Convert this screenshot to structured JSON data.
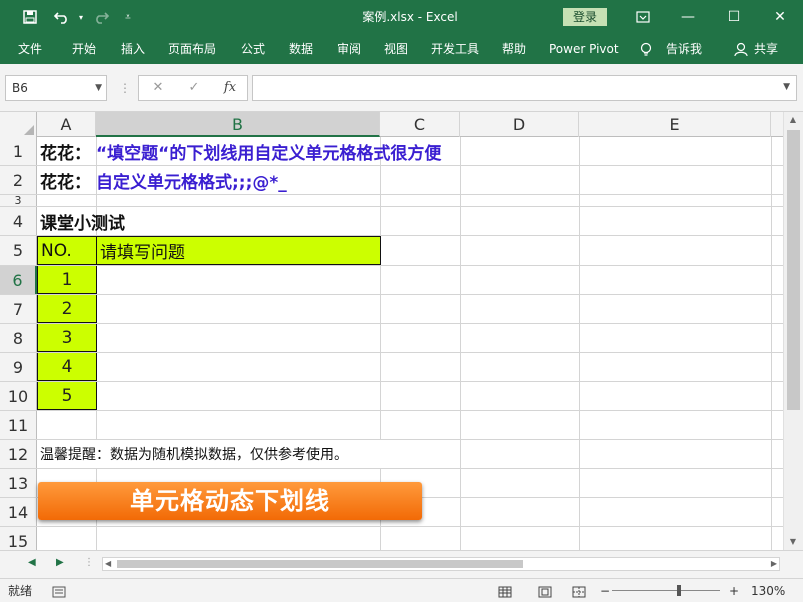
{
  "window": {
    "title": "案例.xlsx  -  Excel",
    "login_label": "登录",
    "minimize": "—",
    "restore": "☐",
    "close": "✕",
    "qat": {
      "save_icon": "save-icon",
      "undo_icon": "undo-icon",
      "redo_icon": "redo-icon",
      "customize_icon": "customize-icon"
    }
  },
  "ribbon": {
    "tabs": [
      "文件",
      "开始",
      "插入",
      "页面布局",
      "公式",
      "数据",
      "审阅",
      "视图",
      "开发工具",
      "帮助",
      "Power Pivot",
      "告诉我",
      "共享"
    ],
    "colors": {
      "brand": "#217346"
    }
  },
  "formula_bar": {
    "name_box": "B6",
    "cancel_symbol": "✕",
    "enter_symbol": "✓",
    "fx_symbol": "fx",
    "formula": ""
  },
  "grid": {
    "columns": [
      "A",
      "B",
      "C",
      "D",
      "E"
    ],
    "rows": [
      "1",
      "2",
      "3",
      "4",
      "5",
      "6",
      "7",
      "8",
      "9",
      "10",
      "11",
      "12",
      "13",
      "14",
      "15"
    ],
    "cells": {
      "A1": "花花：",
      "B1": "“填空题“的下划线用自定义单元格格式很方便",
      "A2": "花花：",
      "B2": "自定义单元格格式;;;@*_",
      "A4": "课堂小测试",
      "A5": "NO.",
      "B5": "请填写问题",
      "A6": "1",
      "A7": "2",
      "A8": "3",
      "A9": "4",
      "A10": "5",
      "A12": "温馨提醒：数据为随机模拟数据，仅供参考使用。"
    },
    "banner": "单元格动态下划线",
    "colors": {
      "highlight": "#ccff00",
      "purple_text": "#3a1fd1",
      "banner": "#f26a06"
    }
  },
  "statusbar": {
    "ready": "就绪",
    "zoom": "130%",
    "zoom_minus": "−",
    "zoom_plus": "+"
  }
}
